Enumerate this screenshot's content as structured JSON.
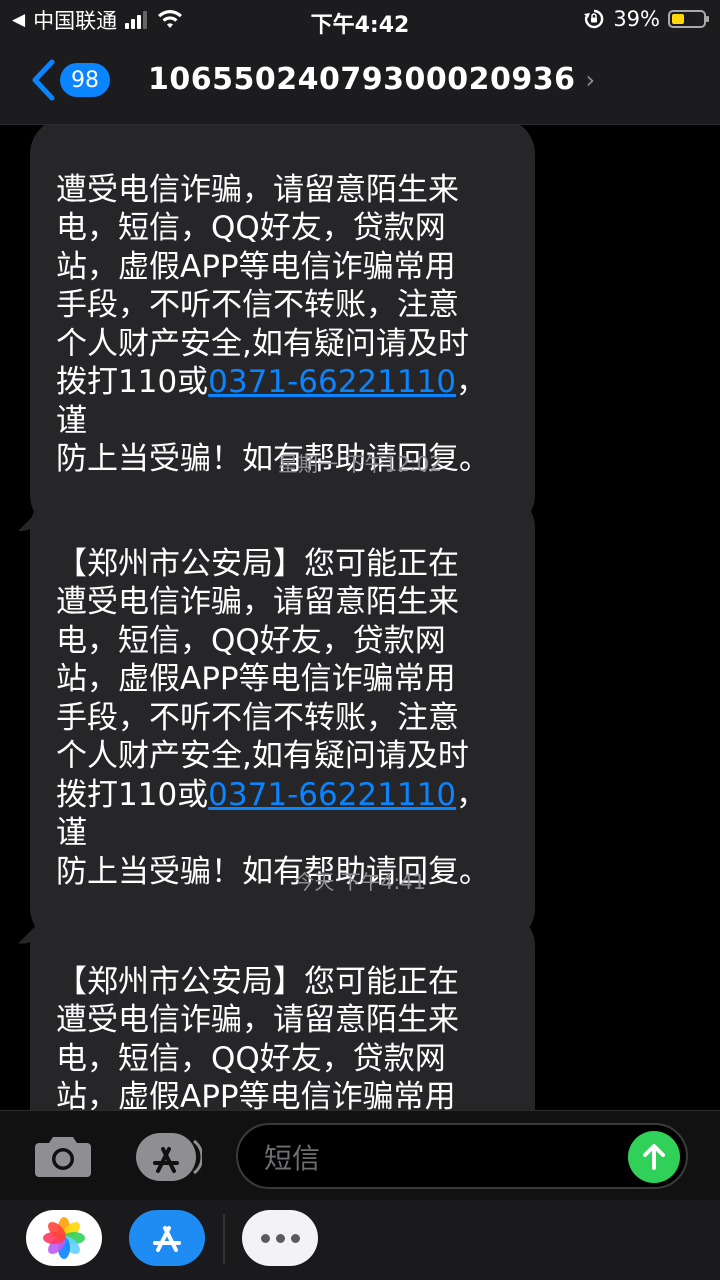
{
  "status_bar": {
    "back_to_app_indicator": "◀",
    "carrier": "中国联通",
    "time": "下午4:42",
    "battery_percent": "39%",
    "battery_level": 0.39,
    "battery_color": "#ffd60a"
  },
  "nav": {
    "back_badge_count": "98",
    "contact": "10655024079300020936",
    "chevron": "›"
  },
  "messages": [
    {
      "text_before_link": "遭受电信诈骗，请留意陌生来\n电，短信，QQ好友，贷款网\n站，虚假APP等电信诈骗常用\n手段，不听不信不转账，注意\n个人财产安全,如有疑问请及时\n拨打110或",
      "link": "0371-66221110",
      "text_after_link": "，谨\n防上当受骗！如有帮助请回复。"
    },
    {
      "timestamp": "星期一 下午12:02",
      "text_before_link": "【郑州市公安局】您可能正在\n遭受电信诈骗，请留意陌生来\n电，短信，QQ好友，贷款网\n站，虚假APP等电信诈骗常用\n手段，不听不信不转账，注意\n个人财产安全,如有疑问请及时\n拨打110或",
      "link": "0371-66221110",
      "text_after_link": "，谨\n防上当受骗！如有帮助请回复。"
    },
    {
      "timestamp": "今天 下午4:41",
      "text_before_link": "【郑州市公安局】您可能正在\n遭受电信诈骗，请留意陌生来\n电，短信，QQ好友，贷款网\n站，虚假APP等电信诈骗常用\n手段，不听不信不转账，注意",
      "link": "",
      "text_after_link": ""
    }
  ],
  "input": {
    "placeholder": "短信"
  },
  "icons": {
    "camera": "camera-icon",
    "app_store": "app-store-icon",
    "send": "send-arrow-icon",
    "photos": "photos-app-icon",
    "more": "more-icon"
  },
  "colors": {
    "link": "#0a84ff",
    "send": "#30d158",
    "bubble": "#262628",
    "timestamp": "#8e8e93"
  }
}
